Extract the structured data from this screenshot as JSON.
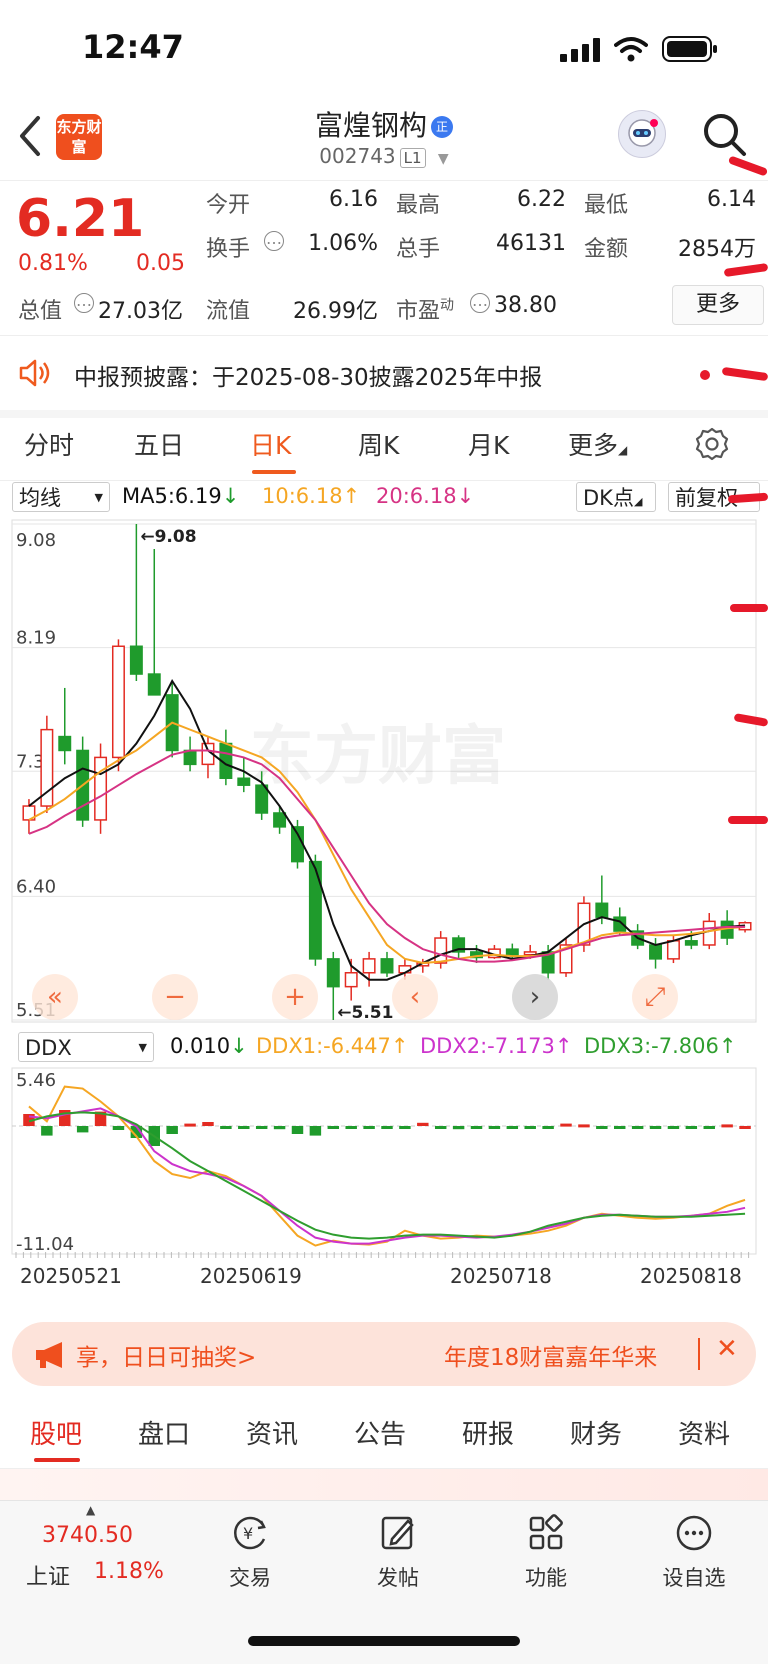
{
  "status_bar": {
    "time": "12:47"
  },
  "header": {
    "logo_text": "东方财富",
    "stock_name": "富煌钢构",
    "badge": "正",
    "stock_code": "002743",
    "level": "L1"
  },
  "quote": {
    "price": "6.21",
    "change_pct": "0.81%",
    "change_amt": "0.05",
    "open_label": "今开",
    "open": "6.16",
    "high_label": "最高",
    "high": "6.22",
    "low_label": "最低",
    "low": "6.14",
    "turnover_label": "换手",
    "turnover": "1.06%",
    "volume_label": "总手",
    "volume": "46131",
    "amount_label": "金额",
    "amount": "2854万",
    "mktcap_label": "总值",
    "mktcap": "27.03亿",
    "float_label": "流值",
    "float_cap": "26.99亿",
    "pe_label": "市盈",
    "pe_sup": "动",
    "pe": "38.80",
    "more_label": "更多"
  },
  "notice": {
    "text": "中报预披露：于2025-08-30披露2025年中报"
  },
  "chart_tabs": {
    "items": [
      "分时",
      "五日",
      "日K",
      "周K",
      "月K",
      "更多"
    ],
    "active": "日K"
  },
  "ma_bar": {
    "indicator": "均线",
    "ma5": "MA5:6.19",
    "ma10": "10:6.18",
    "ma20": "20:6.18",
    "dk_label": "DK点",
    "adjust_label": "前复权"
  },
  "ddx_bar": {
    "indicator": "DDX",
    "ddx": "0.010",
    "ddx1": "DDX1:-6.447",
    "ddx2": "DDX2:-7.173",
    "ddx3": "DDX3:-7.806"
  },
  "watermark": "东方财富",
  "chart_data": [
    {
      "type": "candlestick",
      "y_ticks": [
        "9.08",
        "8.19",
        "7.3",
        "6.40",
        "5.51"
      ],
      "ylim": [
        5.51,
        9.08
      ],
      "max_label": "9.08",
      "min_label": "5.51",
      "colors": {
        "up": "#e32b22",
        "down": "#1f9b2c",
        "ma5": "#111111",
        "ma10": "#f5a623",
        "ma20": "#d63384"
      },
      "series": [
        {
          "name": "MA5",
          "values": [
            7.05,
            7.15,
            7.25,
            7.32,
            7.28,
            7.35,
            7.5,
            7.7,
            7.95,
            7.75,
            7.45,
            7.35,
            7.3,
            7.22,
            7.05,
            6.85,
            6.6,
            6.2,
            5.9,
            5.8,
            5.8,
            5.85,
            5.92,
            5.98,
            6.02,
            6.02,
            5.98,
            5.95,
            5.97,
            6.0,
            6.1,
            6.2,
            6.25,
            6.22,
            6.1,
            6.05,
            6.08,
            6.12,
            6.15,
            6.18,
            6.19
          ]
        },
        {
          "name": "10",
          "values": [
            6.95,
            7.02,
            7.1,
            7.2,
            7.3,
            7.38,
            7.45,
            7.55,
            7.65,
            7.6,
            7.55,
            7.5,
            7.45,
            7.4,
            7.3,
            7.15,
            6.95,
            6.7,
            6.45,
            6.25,
            6.05,
            5.95,
            5.92,
            5.93,
            5.95,
            5.97,
            5.98,
            5.97,
            5.97,
            5.98,
            6.03,
            6.07,
            6.12,
            6.14,
            6.13,
            6.12,
            6.12,
            6.13,
            6.15,
            6.17,
            6.18
          ]
        },
        {
          "name": "20",
          "values": [
            6.85,
            6.9,
            6.98,
            7.05,
            7.12,
            7.2,
            7.28,
            7.35,
            7.42,
            7.45,
            7.45,
            7.43,
            7.4,
            7.35,
            7.25,
            7.1,
            6.95,
            6.75,
            6.55,
            6.35,
            6.2,
            6.1,
            6.02,
            5.98,
            5.95,
            5.93,
            5.93,
            5.94,
            5.96,
            5.98,
            6.02,
            6.06,
            6.1,
            6.12,
            6.13,
            6.14,
            6.15,
            6.16,
            6.17,
            6.18,
            6.18
          ]
        }
      ],
      "candles": [
        {
          "o": 6.95,
          "h": 7.1,
          "l": 6.85,
          "c": 7.05
        },
        {
          "o": 7.05,
          "h": 7.7,
          "l": 7.0,
          "c": 7.6
        },
        {
          "o": 7.55,
          "h": 7.9,
          "l": 7.35,
          "c": 7.45
        },
        {
          "o": 7.45,
          "h": 7.55,
          "l": 6.9,
          "c": 6.95
        },
        {
          "o": 6.95,
          "h": 7.5,
          "l": 6.85,
          "c": 7.4
        },
        {
          "o": 7.4,
          "h": 8.25,
          "l": 7.3,
          "c": 8.2
        },
        {
          "o": 8.2,
          "h": 9.08,
          "l": 7.95,
          "c": 8.0
        },
        {
          "o": 8.0,
          "h": 8.9,
          "l": 7.9,
          "c": 7.85
        },
        {
          "o": 7.85,
          "h": 7.95,
          "l": 7.4,
          "c": 7.45
        },
        {
          "o": 7.45,
          "h": 7.55,
          "l": 7.3,
          "c": 7.35
        },
        {
          "o": 7.35,
          "h": 7.55,
          "l": 7.25,
          "c": 7.5
        },
        {
          "o": 7.5,
          "h": 7.6,
          "l": 7.2,
          "c": 7.25
        },
        {
          "o": 7.25,
          "h": 7.4,
          "l": 7.15,
          "c": 7.2
        },
        {
          "o": 7.2,
          "h": 7.3,
          "l": 6.95,
          "c": 7.0
        },
        {
          "o": 7.0,
          "h": 7.05,
          "l": 6.85,
          "c": 6.9
        },
        {
          "o": 6.9,
          "h": 6.95,
          "l": 6.6,
          "c": 6.65
        },
        {
          "o": 6.65,
          "h": 6.7,
          "l": 5.9,
          "c": 5.95
        },
        {
          "o": 5.95,
          "h": 6.0,
          "l": 5.51,
          "c": 5.75
        },
        {
          "o": 5.75,
          "h": 5.95,
          "l": 5.65,
          "c": 5.85
        },
        {
          "o": 5.85,
          "h": 6.0,
          "l": 5.75,
          "c": 5.95
        },
        {
          "o": 5.95,
          "h": 6.0,
          "l": 5.82,
          "c": 5.85
        },
        {
          "o": 5.85,
          "h": 5.95,
          "l": 5.8,
          "c": 5.9
        },
        {
          "o": 5.9,
          "h": 5.95,
          "l": 5.85,
          "c": 5.92
        },
        {
          "o": 5.92,
          "h": 6.15,
          "l": 5.88,
          "c": 6.1
        },
        {
          "o": 6.1,
          "h": 6.12,
          "l": 5.95,
          "c": 6.0
        },
        {
          "o": 6.0,
          "h": 6.05,
          "l": 5.92,
          "c": 5.96
        },
        {
          "o": 5.96,
          "h": 6.05,
          "l": 5.95,
          "c": 6.02
        },
        {
          "o": 6.02,
          "h": 6.06,
          "l": 5.95,
          "c": 5.98
        },
        {
          "o": 5.98,
          "h": 6.05,
          "l": 5.95,
          "c": 6.0
        },
        {
          "o": 6.0,
          "h": 6.05,
          "l": 5.8,
          "c": 5.85
        },
        {
          "o": 5.85,
          "h": 6.1,
          "l": 5.82,
          "c": 6.05
        },
        {
          "o": 6.05,
          "h": 6.4,
          "l": 6.0,
          "c": 6.35
        },
        {
          "o": 6.35,
          "h": 6.55,
          "l": 6.2,
          "c": 6.25
        },
        {
          "o": 6.25,
          "h": 6.32,
          "l": 6.12,
          "c": 6.15
        },
        {
          "o": 6.15,
          "h": 6.2,
          "l": 6.02,
          "c": 6.05
        },
        {
          "o": 6.05,
          "h": 6.1,
          "l": 5.88,
          "c": 5.95
        },
        {
          "o": 5.95,
          "h": 6.12,
          "l": 5.92,
          "c": 6.08
        },
        {
          "o": 6.08,
          "h": 6.15,
          "l": 6.02,
          "c": 6.05
        },
        {
          "o": 6.05,
          "h": 6.28,
          "l": 6.02,
          "c": 6.22
        },
        {
          "o": 6.22,
          "h": 6.3,
          "l": 6.05,
          "c": 6.1
        },
        {
          "o": 6.16,
          "h": 6.22,
          "l": 6.14,
          "c": 6.21
        }
      ]
    },
    {
      "type": "line",
      "y_ticks": [
        "5.46",
        "-11.04"
      ],
      "ylim": [
        -11.04,
        5.46
      ],
      "colors": {
        "ddx1": "#f5a623",
        "ddx2": "#cc33cc",
        "ddx3": "#2f9e2f"
      },
      "x_ticks": [
        "20250521",
        "20250619",
        "20250718",
        "20250818"
      ],
      "ddx_bars": [
        1.5,
        -1.2,
        2.0,
        -0.8,
        1.8,
        -0.5,
        -1.5,
        -2.5,
        -1.0,
        0.3,
        0.5,
        -0.2,
        -0.3,
        -0.3,
        -0.4,
        -1.0,
        -1.2,
        -0.3,
        -0.2,
        -0.2,
        -0.3,
        -0.2,
        0.4,
        -0.3,
        -0.4,
        -0.3,
        -0.2,
        -0.3,
        -0.2,
        -0.3,
        0.3,
        0.2,
        -0.2,
        -0.3,
        -0.2,
        -0.2,
        -0.2,
        -0.3,
        -0.2,
        0.2,
        0.0
      ],
      "series": [
        {
          "name": "DDX1",
          "values": [
            3.0,
            1.5,
            5.0,
            4.8,
            3.5,
            2.0,
            0.0,
            -2.5,
            -3.8,
            -4.2,
            -3.5,
            -4.0,
            -5.0,
            -6.0,
            -8.0,
            -10.0,
            -11.0,
            -10.5,
            -10.8,
            -10.9,
            -10.6,
            -9.5,
            -10.0,
            -10.3,
            -10.2,
            -10.0,
            -10.1,
            -10.0,
            -9.8,
            -9.5,
            -9.0,
            -8.2,
            -7.8,
            -8.0,
            -8.2,
            -8.3,
            -8.2,
            -8.0,
            -7.8,
            -7.0,
            -6.4
          ]
        },
        {
          "name": "DDX2",
          "values": [
            2.0,
            1.8,
            2.2,
            2.5,
            2.8,
            2.0,
            1.0,
            -1.5,
            -2.8,
            -3.5,
            -3.8,
            -4.2,
            -5.0,
            -6.0,
            -7.5,
            -9.0,
            -10.2,
            -10.6,
            -10.8,
            -10.8,
            -10.5,
            -10.2,
            -10.0,
            -10.0,
            -10.1,
            -10.2,
            -10.1,
            -9.9,
            -9.6,
            -9.2,
            -8.8,
            -8.2,
            -7.9,
            -7.9,
            -8.0,
            -8.1,
            -8.1,
            -8.0,
            -7.8,
            -7.6,
            -7.2
          ]
        },
        {
          "name": "DDX3",
          "values": [
            1.5,
            2.0,
            2.3,
            2.4,
            2.3,
            2.0,
            1.2,
            0.0,
            -1.2,
            -2.5,
            -3.5,
            -4.5,
            -5.5,
            -6.5,
            -7.5,
            -8.5,
            -9.4,
            -9.9,
            -10.2,
            -10.3,
            -10.2,
            -10.0,
            -9.9,
            -9.9,
            -10.0,
            -10.1,
            -10.2,
            -10.0,
            -9.6,
            -9.0,
            -8.6,
            -8.2,
            -8.0,
            -7.9,
            -8.0,
            -8.1,
            -8.1,
            -8.1,
            -8.0,
            -7.9,
            -7.8
          ]
        }
      ]
    }
  ],
  "ad": {
    "left_text": "享，日日可抽奖>",
    "right_text": "年度18财富嘉年华来"
  },
  "bottom_tabs": {
    "items": [
      "股吧",
      "盘口",
      "资讯",
      "公告",
      "研报",
      "财务",
      "资料"
    ],
    "active": "股吧"
  },
  "bottom_bar": {
    "index_value": "3740.50",
    "index_name": "上证",
    "index_change": "1.18%",
    "items": [
      "交易",
      "发帖",
      "功能",
      "设自选"
    ]
  }
}
